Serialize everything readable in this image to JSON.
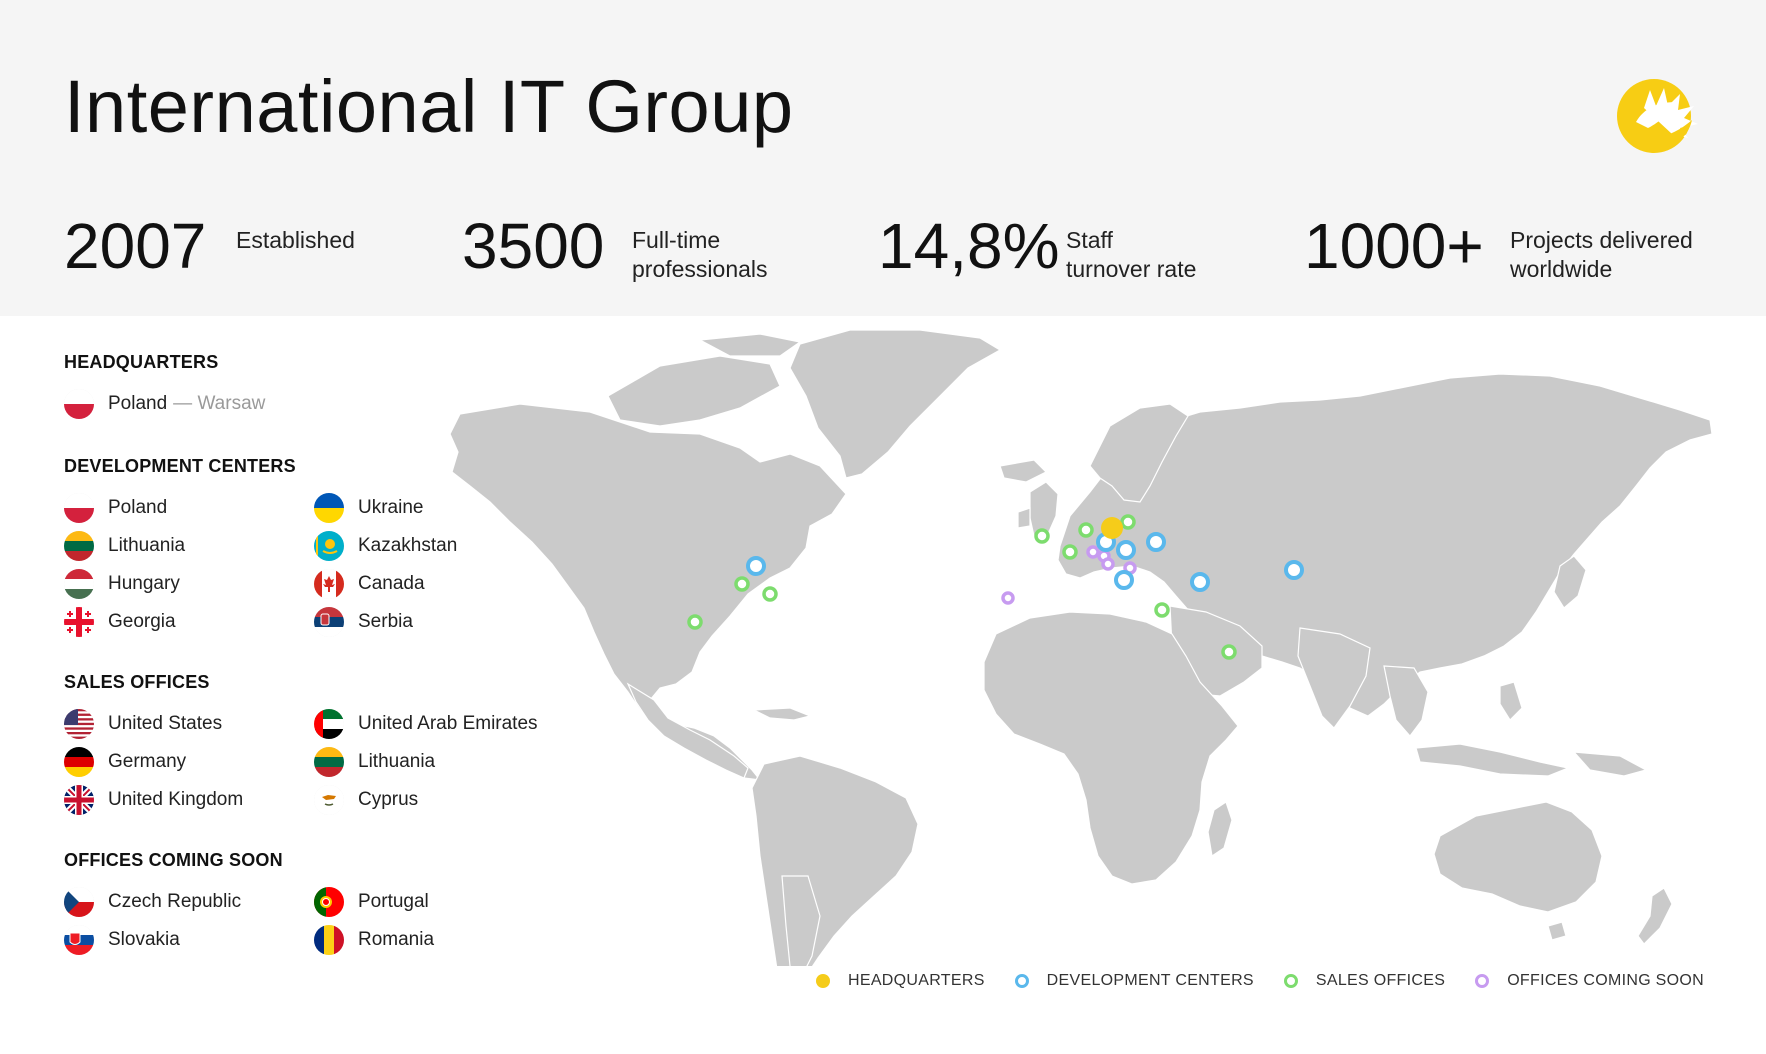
{
  "header": {
    "title": "International IT Group",
    "logo_icon": "sun-leaf-logo-icon",
    "stats": [
      {
        "value": "2007",
        "label_lines": [
          "Established"
        ]
      },
      {
        "value": "3500",
        "label_lines": [
          "Full-time",
          "professionals"
        ]
      },
      {
        "value": "14,8%",
        "label_lines": [
          "Staff",
          "turnover rate"
        ]
      },
      {
        "value": "1000+",
        "label_lines": [
          "Projects delivered",
          "worldwide"
        ]
      }
    ]
  },
  "legend": {
    "headquarters": {
      "title": "HEADQUARTERS",
      "items": [
        {
          "country": "Poland",
          "city": "— Warsaw",
          "flag": "poland-flag-icon"
        }
      ]
    },
    "development_centers": {
      "title": "DEVELOPMENT CENTERS",
      "items": [
        {
          "country": "Poland",
          "flag": "poland-flag-icon"
        },
        {
          "country": "Lithuania",
          "flag": "lithuania-flag-icon"
        },
        {
          "country": "Hungary",
          "flag": "hungary-flag-icon"
        },
        {
          "country": "Georgia",
          "flag": "georgia-flag-icon"
        },
        {
          "country": "Ukraine",
          "flag": "ukraine-flag-icon"
        },
        {
          "country": "Kazakhstan",
          "flag": "kazakhstan-flag-icon"
        },
        {
          "country": "Canada",
          "flag": "canada-flag-icon"
        },
        {
          "country": "Serbia",
          "flag": "serbia-flag-icon"
        }
      ]
    },
    "sales_offices": {
      "title": "SALES OFFICES",
      "items": [
        {
          "country": "United States",
          "flag": "usa-flag-icon"
        },
        {
          "country": "Germany",
          "flag": "germany-flag-icon"
        },
        {
          "country": "United Kingdom",
          "flag": "uk-flag-icon"
        },
        {
          "country": "United Arab Emirates",
          "flag": "uae-flag-icon"
        },
        {
          "country": "Lithuania",
          "flag": "lithuania-flag-icon"
        },
        {
          "country": "Cyprus",
          "flag": "cyprus-flag-icon"
        }
      ]
    },
    "coming_soon": {
      "title": "OFFICES COMING SOON",
      "items": [
        {
          "country": "Czech Republic",
          "flag": "czech-flag-icon"
        },
        {
          "country": "Slovakia",
          "flag": "slovakia-flag-icon"
        },
        {
          "country": "Portugal",
          "flag": "portugal-flag-icon"
        },
        {
          "country": "Romania",
          "flag": "romania-flag-icon"
        }
      ]
    }
  },
  "map": {
    "colors": {
      "land": "#cacaca",
      "headquarters": "#f5cc1a",
      "development": "#5ab8ec",
      "sales": "#7ddc6e",
      "coming_soon": "#c79bf0"
    }
  },
  "map_legend": [
    {
      "label": "HEADQUARTERS",
      "kind": "headquarters"
    },
    {
      "label": "DEVELOPMENT CENTERS",
      "kind": "development"
    },
    {
      "label": "SALES OFFICES",
      "kind": "sales"
    },
    {
      "label": "OFFICES COMING SOON",
      "kind": "coming_soon"
    }
  ]
}
